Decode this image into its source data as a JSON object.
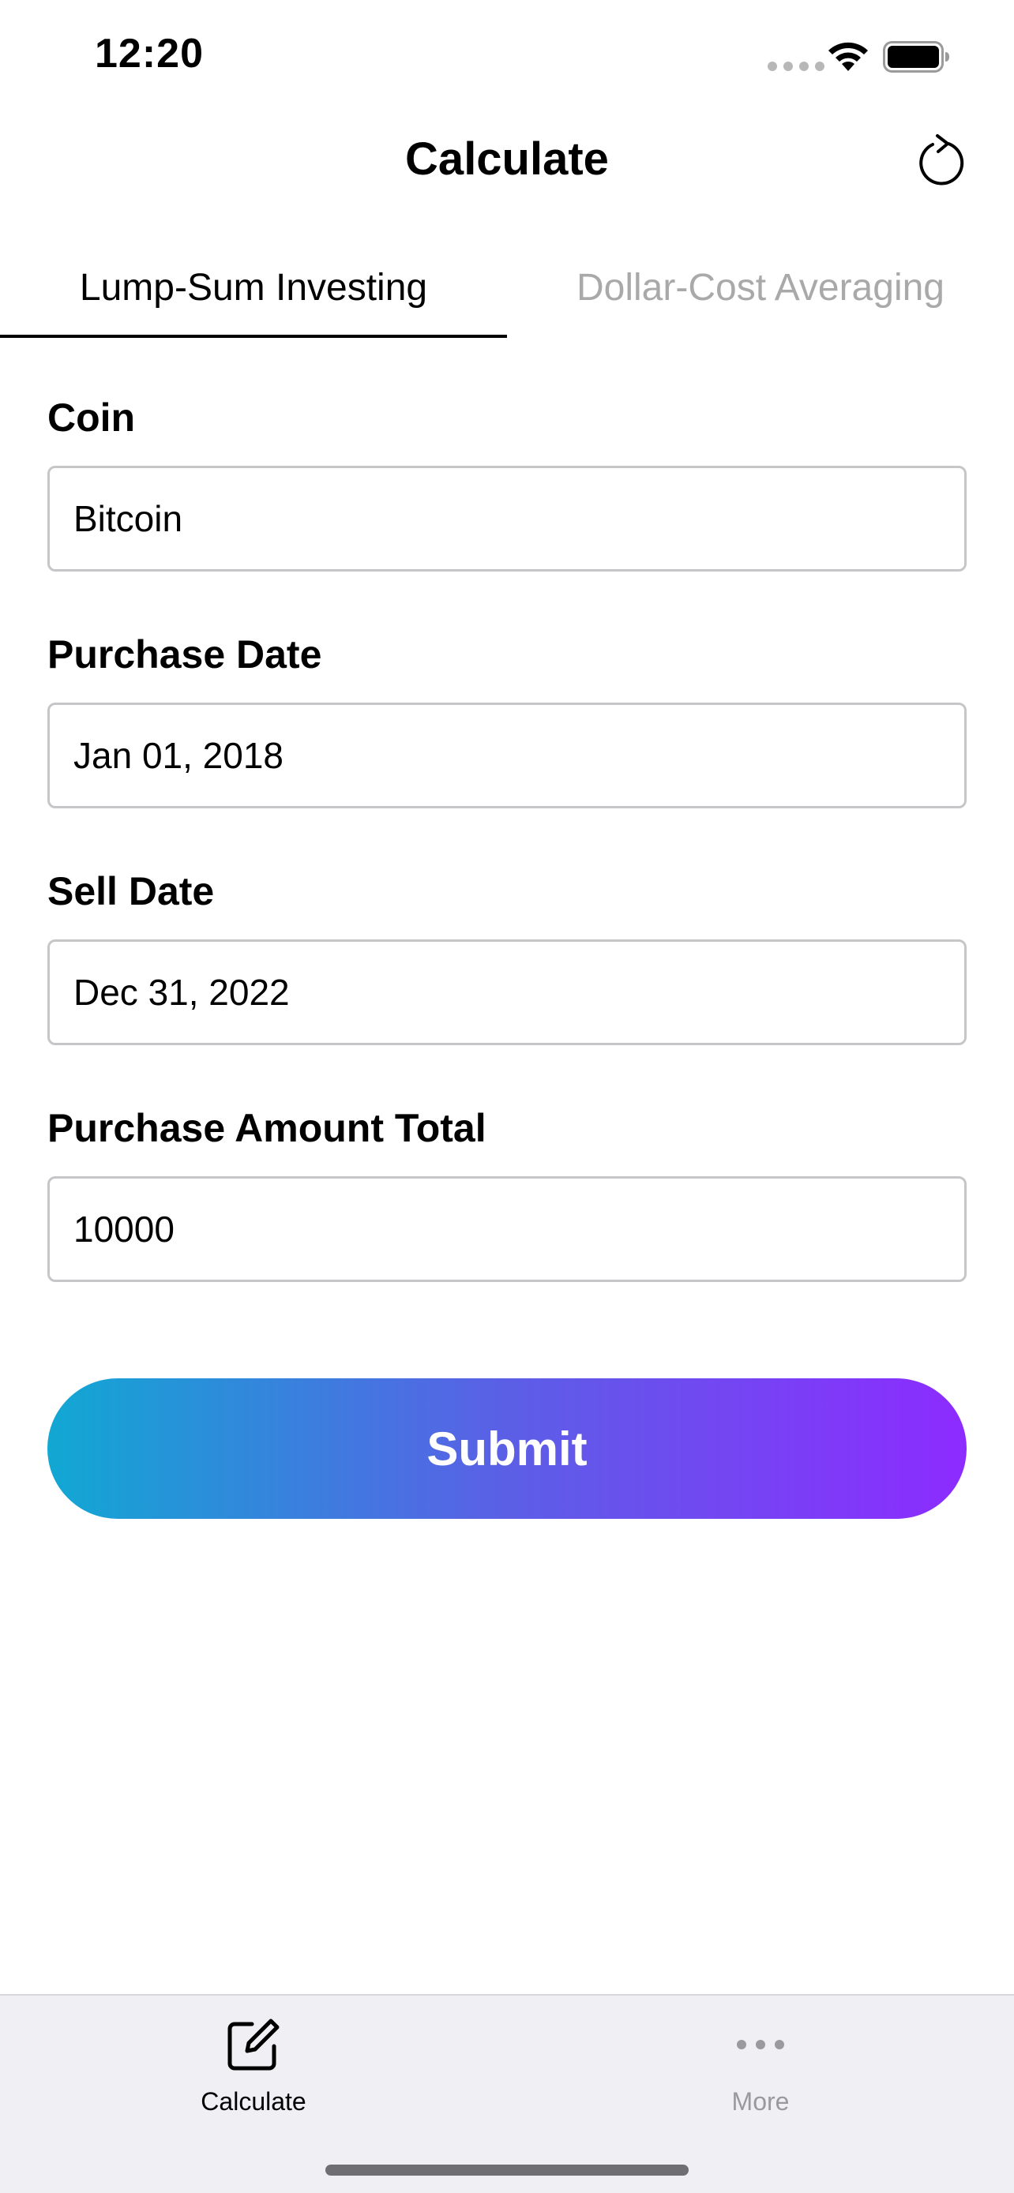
{
  "status_bar": {
    "time": "12:20"
  },
  "nav": {
    "title": "Calculate",
    "reset_icon": "reset-icon"
  },
  "segments": [
    {
      "label": "Lump-Sum Investing",
      "active": true
    },
    {
      "label": "Dollar-Cost Averaging",
      "active": false
    }
  ],
  "form": {
    "coin": {
      "label": "Coin",
      "value": "Bitcoin"
    },
    "purchase_date": {
      "label": "Purchase Date",
      "value": "Jan 01, 2018"
    },
    "sell_date": {
      "label": "Sell Date",
      "value": "Dec 31, 2022"
    },
    "amount": {
      "label": "Purchase Amount Total",
      "value": "10000"
    }
  },
  "submit": {
    "label": "Submit",
    "gradient_start": "#11a8d3",
    "gradient_end": "#8d2bff"
  },
  "tab_bar": {
    "items": [
      {
        "label": "Calculate",
        "icon": "compose-icon",
        "active": true
      },
      {
        "label": "More",
        "icon": "more-icon",
        "active": false
      }
    ]
  }
}
